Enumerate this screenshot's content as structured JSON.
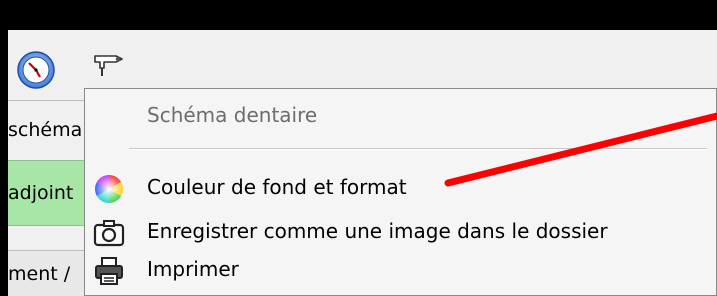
{
  "strip": {
    "row1": "schéma",
    "row2": "adjoint",
    "row3": "ment /"
  },
  "menu": {
    "title": "Schéma dentaire",
    "items": [
      {
        "label": "Couleur de fond et format",
        "icon": "color-wheel-icon"
      },
      {
        "label": "Enregistrer comme une image dans le dossier",
        "icon": "camera-icon"
      },
      {
        "label": "Imprimer",
        "icon": "printer-icon"
      }
    ]
  },
  "toolbar": {
    "buttons": [
      "clock-icon",
      "dental-drill-icon"
    ]
  },
  "colors": {
    "highlight_green": "#a8e6a8",
    "annotation_red": "#ff0000"
  }
}
